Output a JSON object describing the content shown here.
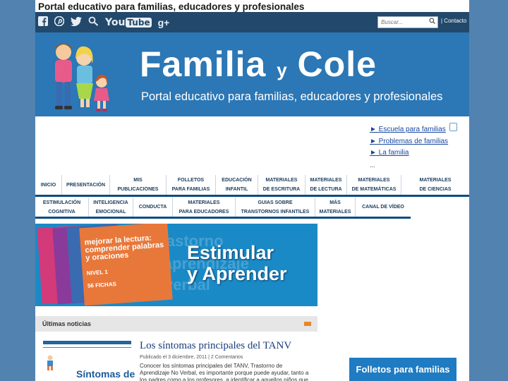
{
  "site_title": "Portal educativo para familias, educadores y profesionales",
  "topbar": {
    "social": [
      "facebook-icon",
      "pinterest-icon",
      "twitter-icon",
      "search-people-icon",
      "youtube-icon",
      "google-plus-icon"
    ],
    "social_glyphs": {
      "g": "g+"
    },
    "youtube_text_a": "You",
    "youtube_text_b": "Tube",
    "search_placeholder": "Buscar...",
    "contact_label": "| Contacto"
  },
  "banner": {
    "brand_a": "Familia ",
    "brand_y": "y",
    "brand_b": " Cole",
    "tagline": "Portal educativo para familias, educadores y profesionales"
  },
  "quicklinks": {
    "items": [
      "► Escuela para familias",
      "► Problemas de familias",
      "► La familia"
    ],
    "more": "..."
  },
  "nav1": [
    "INICIO",
    "PRESENTACIÓN",
    "MIS\nPUBLICACIONES",
    "FOLLETOS\nPARA FAMILIAS",
    "EDUCACIÓN\nINFANTIL",
    "MATERIALES\nDE ESCRITURA",
    "MATERIALES\nDE LECTURA",
    "MATERIALES\nDE MATEMÁTICAS",
    "MATERIALES\nDE CIENCIAS"
  ],
  "nav2": [
    "ESTIMULACIÓN\nCOGNITIVA",
    "INTELIGENCIA\nEMOCIONAL",
    "CONDUCTA",
    "MATERIALES\nPARA EDUCADORES",
    "GUIAS SOBRE\nTRANSTORNOS INFANTILES",
    "MÁS\nMATERIALES",
    "CANAL DE VÍDEO"
  ],
  "promo": {
    "title": "Estimular\ny Aprender",
    "book_text_1": "mejorar la lectura:",
    "book_text_2": "comprender palabras",
    "book_text_3": "y oraciones",
    "book_level": "NIVEL 1",
    "book_count": "56 FICHAS",
    "bg_1": "trastorno",
    "bg_2": "de aprendizaje",
    "bg_3": "no verbal",
    "colors": {
      "bg": "#1a8ac6",
      "book": "#e8783a"
    }
  },
  "news": {
    "header": "Últimas noticias",
    "title": "Los síntomas principales del TANV",
    "meta": "Publicado el 3 diciembre, 2011  |  2 Comentarios",
    "excerpt": "Conocer los síntomas principales del TANV, Trastorno de Aprendizaje No Verbal, es importante porque puede ayudar, tanto a los padres como a los profesores, a identificar a aquellos niños que",
    "thumb_text": "Síntomas de"
  },
  "sidebar": {
    "button": "Folletos para familias"
  }
}
